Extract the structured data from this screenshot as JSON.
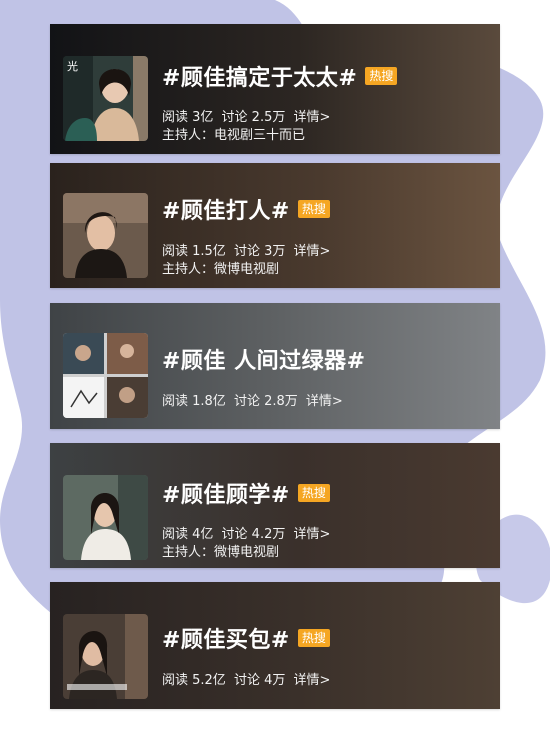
{
  "cards": [
    {
      "title": "#顾佳搞定于太太#",
      "badge": "热搜",
      "read": "阅读 3亿",
      "discuss": "讨论 2.5万",
      "detail": "详情>",
      "host": "主持人：电视剧三十而已"
    },
    {
      "title": "#顾佳打人#",
      "badge": "热搜",
      "read": "阅读 1.5亿",
      "discuss": "讨论 3万",
      "detail": "详情>",
      "host": "主持人：微博电视剧"
    },
    {
      "title": "#顾佳 人间过绿器#",
      "read": "阅读 1.8亿",
      "discuss": "讨论 2.8万",
      "detail": "详情>"
    },
    {
      "title": "#顾佳顾学#",
      "badge": "热搜",
      "read": "阅读 4亿",
      "discuss": "讨论 4.2万",
      "detail": "详情>",
      "host": "主持人：微博电视剧"
    },
    {
      "title": "#顾佳买包#",
      "badge": "热搜",
      "read": "阅读 5.2亿",
      "discuss": "讨论 4万",
      "detail": "详情>"
    }
  ],
  "colors": {
    "badge": "#f5a623",
    "blob": "#b9bce3"
  }
}
